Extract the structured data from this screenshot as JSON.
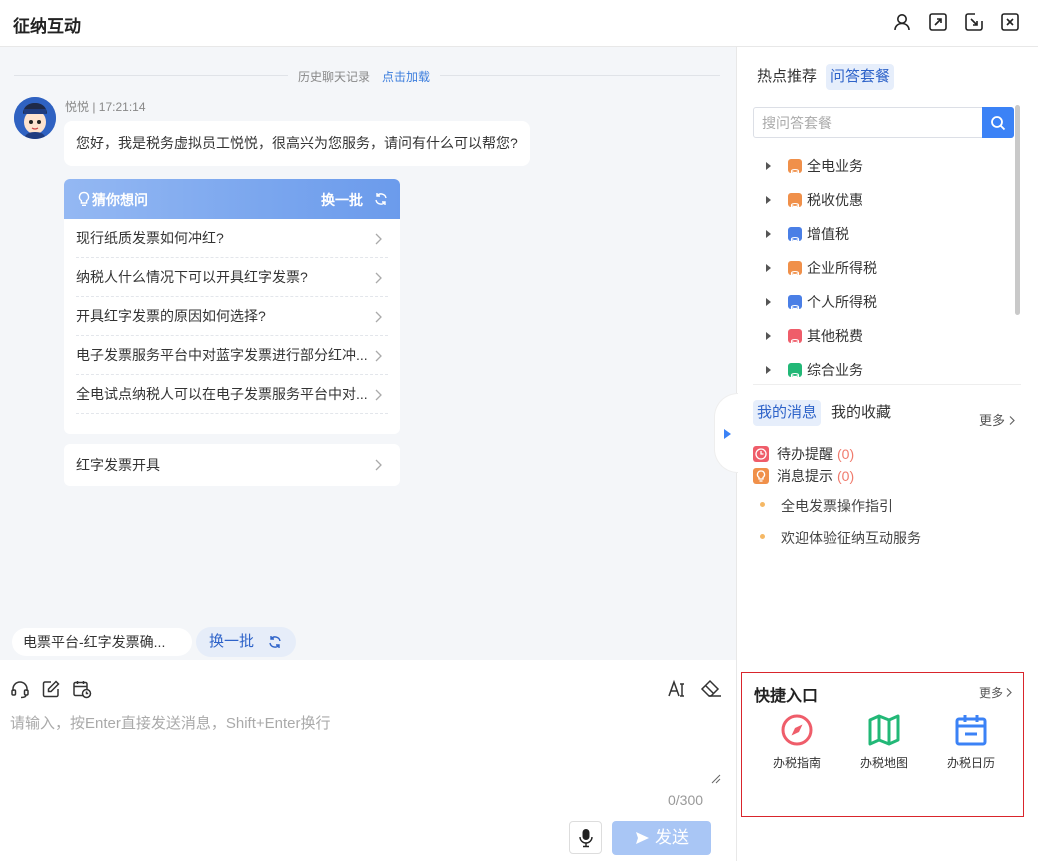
{
  "titlebar": {
    "title": "征纳互动",
    "icons": [
      "user-icon",
      "expand-icon",
      "minimize-to-side-icon",
      "close-icon"
    ]
  },
  "chat": {
    "history_label": "历史聊天记录",
    "load_link": "点击加载",
    "sender_meta": "悦悦 | 17:21:14",
    "greeting": "您好，我是税务虚拟员工悦悦，很高兴为您服务，请问有什么可以帮您?",
    "guess": {
      "title": "猜你想问",
      "swap_label": "换一批",
      "items": [
        "现行纸质发票如何冲红?",
        "纳税人什么情况下可以开具红字发票?",
        "开具红字发票的原因如何选择?",
        "电子发票服务平台中对蓝字发票进行部分红冲...",
        "全电试点纳税人可以在电子发票服务平台中对..."
      ]
    },
    "single_card": "红字发票开具",
    "suggest_chip": "电票平台-红字发票确...",
    "swap_chip": "换一批"
  },
  "input": {
    "placeholder": "请输入，按Enter直接发送消息，Shift+Enter换行",
    "value": "",
    "counter": "0/300",
    "send_label": "发送",
    "tool_icons": [
      "headset-icon",
      "edit-icon",
      "calendar-clock-icon",
      "font-size-icon",
      "eraser-icon",
      "microphone-icon"
    ]
  },
  "right": {
    "tabs": [
      {
        "label": "热点推荐",
        "active": false
      },
      {
        "label": "问答套餐",
        "active": true
      }
    ],
    "search_placeholder": "搜问答套餐",
    "tree": [
      {
        "label": "全电业务",
        "color": "#f0904a"
      },
      {
        "label": "税收优惠",
        "color": "#f0904a"
      },
      {
        "label": "增值税",
        "color": "#4a7fe6"
      },
      {
        "label": "企业所得税",
        "color": "#f0904a"
      },
      {
        "label": "个人所得税",
        "color": "#4a7fe6"
      },
      {
        "label": "其他税费",
        "color": "#ef5d6a"
      },
      {
        "label": "综合业务",
        "color": "#22b877"
      }
    ],
    "msg_tabs": [
      {
        "label": "我的消息",
        "active": true
      },
      {
        "label": "我的收藏",
        "active": false
      }
    ],
    "more": "更多",
    "reminders": [
      {
        "label": "待办提醒",
        "count": "(0)",
        "color": "#ef5d6a",
        "icon": "clock-icon"
      },
      {
        "label": "消息提示",
        "count": "(0)",
        "color": "#f0904a",
        "icon": "bulb-icon"
      }
    ],
    "notices": [
      "全电发票操作指引",
      "欢迎体验征纳互动服务"
    ],
    "quick": {
      "title": "快捷入口",
      "more": "更多",
      "items": [
        {
          "label": "办税指南",
          "color": "#ef5d6a",
          "icon": "compass-icon"
        },
        {
          "label": "办税地图",
          "color": "#22b877",
          "icon": "map-icon"
        },
        {
          "label": "办税日历",
          "color": "#3b82f6",
          "icon": "calendar-icon"
        }
      ]
    }
  }
}
